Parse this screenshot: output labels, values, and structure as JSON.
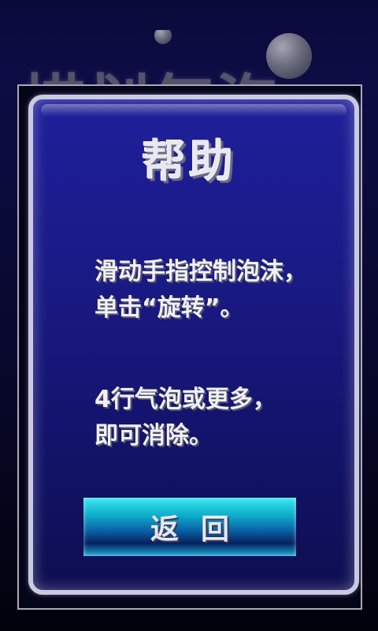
{
  "background": {
    "title_text": "描划气泡"
  },
  "panel": {
    "title": "帮助",
    "paragraph1": [
      "滑动手指控制泡沫，",
      "单击“旋转”。"
    ],
    "paragraph2": [
      "4行气泡或更多，",
      "即可消除。"
    ]
  },
  "buttons": {
    "back_label": "返回"
  },
  "colors": {
    "panel_blue": "#1a1a86",
    "button_cyan": "#0fb2cc",
    "text_white": "#f0f0f6"
  }
}
